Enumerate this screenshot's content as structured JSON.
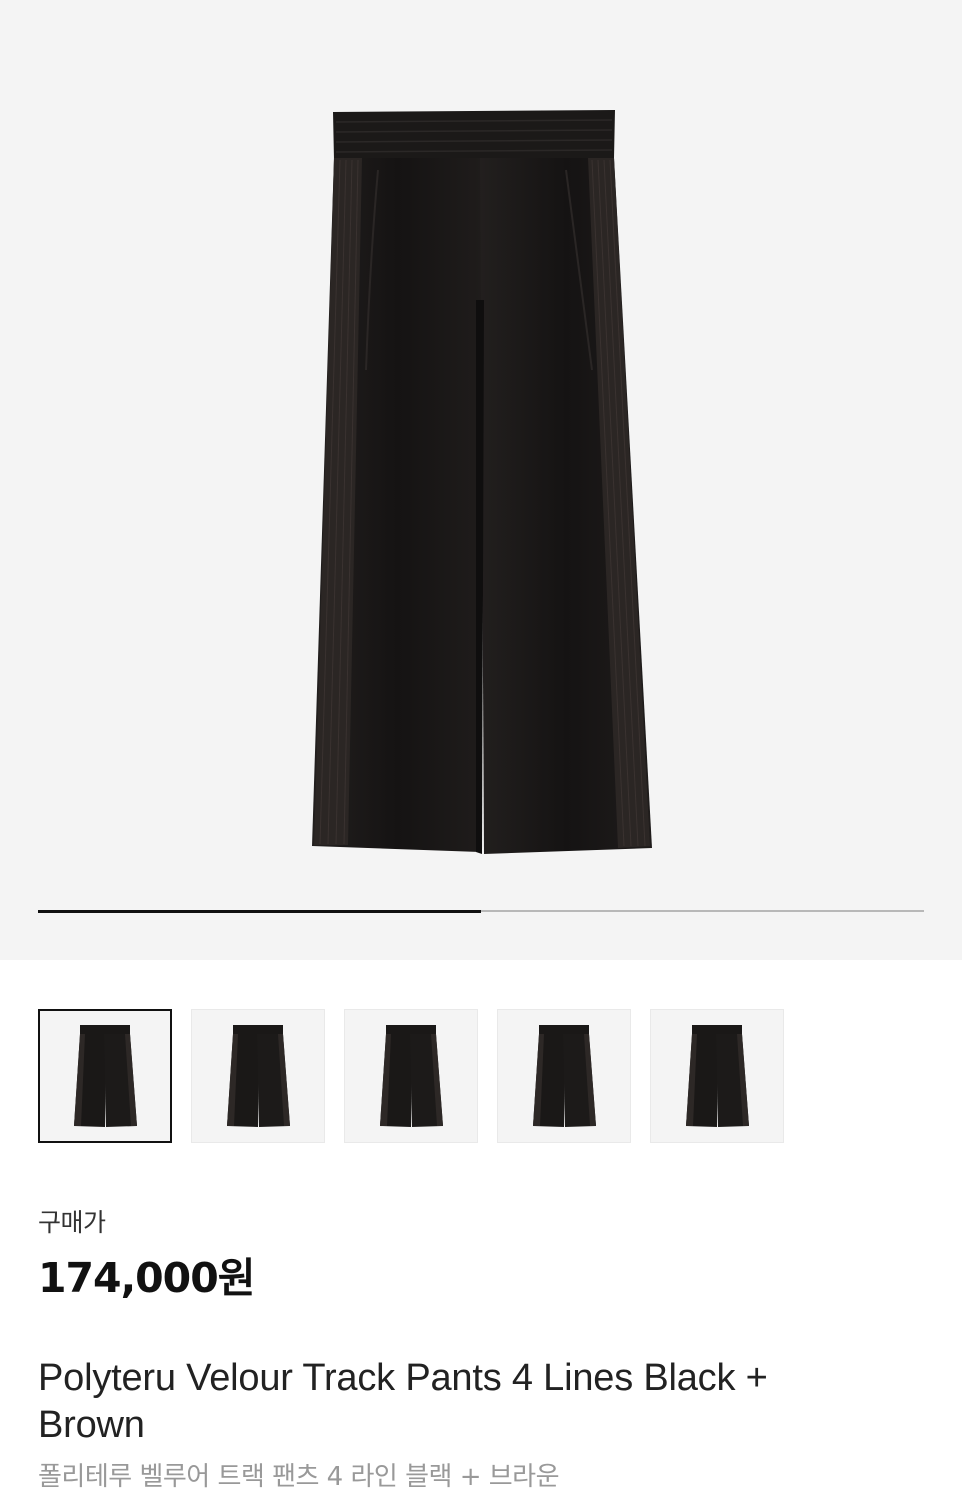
{
  "gallery": {
    "main_image_alt": "black pants icon",
    "progress_percent": 50,
    "thumbnails": [
      {
        "icon": "pants-black-thumbnail-icon",
        "selected": true
      },
      {
        "icon": "pants-black-thumbnail-icon",
        "selected": false
      },
      {
        "icon": "pants-black-thumbnail-icon",
        "selected": false
      },
      {
        "icon": "pants-black-thumbnail-icon",
        "selected": false
      },
      {
        "icon": "pants-black-thumbnail-icon",
        "selected": false
      }
    ]
  },
  "product": {
    "price_label": "구매가",
    "price": "174,000원",
    "title_en": "Polyteru Velour Track Pants 4 Lines Black + Brown",
    "title_ko": "폴리테루 벨루어 트랙 팬츠 4 라인 블랙 + 브라운"
  },
  "colors": {
    "hero_bg": "#f4f4f4",
    "pants": "#1a1817",
    "stripe": "#2e2826",
    "progress_fill": "#111111",
    "progress_track": "#b8b8b8"
  }
}
